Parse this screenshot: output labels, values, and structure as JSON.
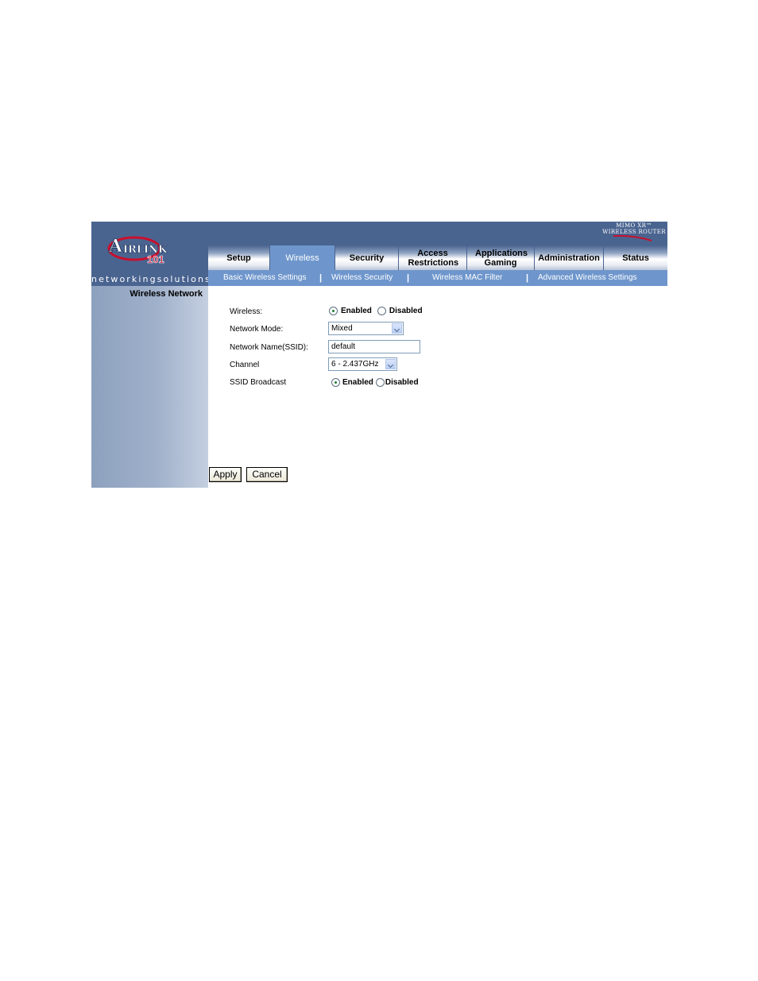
{
  "logo": {
    "brand": "AIRLINK",
    "number": "101",
    "tagline": "networkingsolutions"
  },
  "product": {
    "line1": "MIMO XR™",
    "line2": "WIRELESS ROUTER"
  },
  "tabs": [
    {
      "label": "Setup",
      "active": false
    },
    {
      "label": "Wireless",
      "active": true
    },
    {
      "label": "Security",
      "active": false
    },
    {
      "label": "Access Restrictions",
      "active": false
    },
    {
      "label": "Applications Gaming",
      "active": false
    },
    {
      "label": "Administration",
      "active": false
    },
    {
      "label": "Status",
      "active": false
    }
  ],
  "subnav": [
    {
      "label": "Basic Wireless Settings"
    },
    {
      "label": "Wireless Security"
    },
    {
      "label": "Wireless MAC Filter"
    },
    {
      "label": "Advanced Wireless Settings"
    }
  ],
  "subnav_separator": "|",
  "sidebar": {
    "title": "Wireless Network"
  },
  "form": {
    "wireless": {
      "label": "Wireless:",
      "enabled": "Enabled",
      "disabled": "Disabled",
      "selected": "Enabled"
    },
    "network_mode": {
      "label": "Network Mode:",
      "value": "Mixed"
    },
    "ssid": {
      "label": "Network Name(SSID):",
      "value": "default"
    },
    "channel": {
      "label": "Channel",
      "value": "6 - 2.437GHz"
    },
    "ssid_broadcast": {
      "label": "SSID Broadcast",
      "enabled": "Enabled",
      "disabled": "Disabled",
      "selected": "Enabled"
    }
  },
  "buttons": {
    "apply": "Apply",
    "cancel": "Cancel"
  },
  "colors": {
    "header": "#4a6490",
    "active_tab": "#6e96cc",
    "subnav": "#6e96cc",
    "logo_red": "#c8102e"
  }
}
